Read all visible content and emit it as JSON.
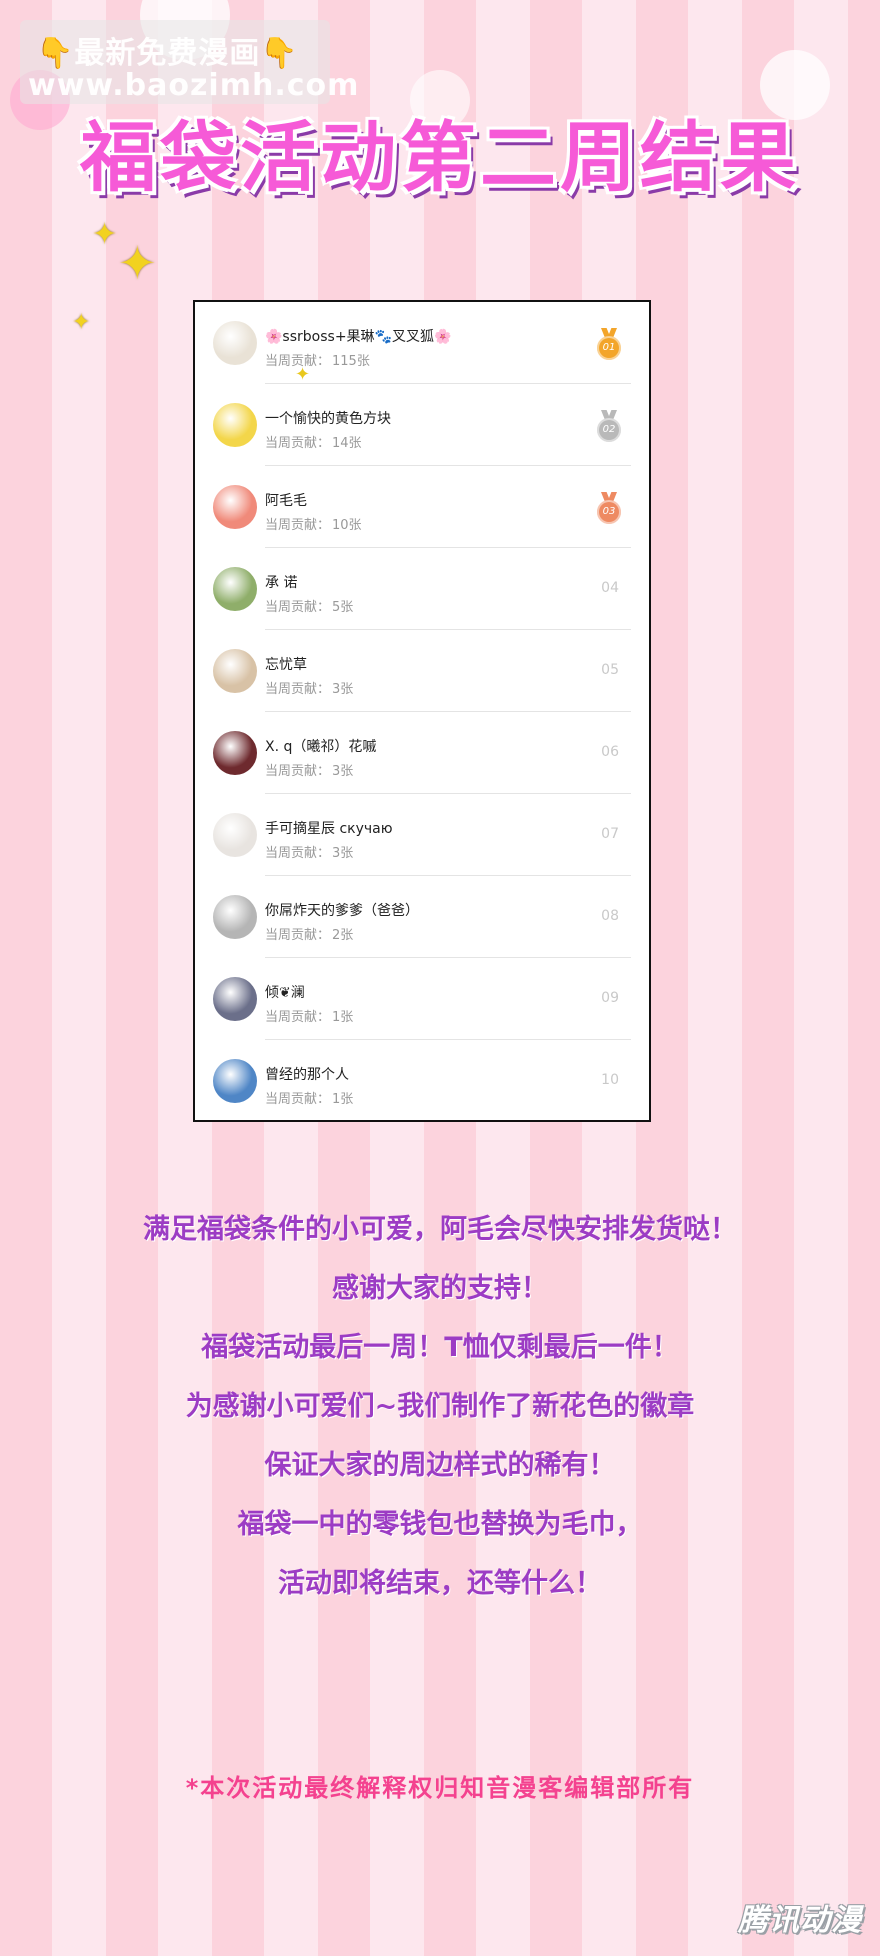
{
  "watermark": {
    "finger_left": "👇",
    "title": "最新免费漫画",
    "finger_right": "👇",
    "url": "www.baozimh.com"
  },
  "page_title": "福袋活动第二周结果",
  "ranking": {
    "contribution_label": "当周贡献：",
    "rows": [
      {
        "name": "🌸ssrboss+果琳🐾叉叉狐🌸",
        "contribution": "115张",
        "rank": "01",
        "medal": "gold",
        "avatar_color": "#e9e2d6"
      },
      {
        "name": "一个愉快的黄色方块",
        "contribution": "14张",
        "rank": "02",
        "medal": "silver",
        "avatar_color": "#f3d64a"
      },
      {
        "name": "阿毛毛",
        "contribution": "10张",
        "rank": "03",
        "medal": "bronze",
        "avatar_color": "#f08a7a"
      },
      {
        "name": "承 诺",
        "contribution": "5张",
        "rank": "04",
        "medal": "",
        "avatar_color": "#8fae6a"
      },
      {
        "name": "忘忧草",
        "contribution": "3张",
        "rank": "05",
        "medal": "",
        "avatar_color": "#d8c2a6"
      },
      {
        "name": "X. q（曦祁）花嘁",
        "contribution": "3张",
        "rank": "06",
        "medal": "",
        "avatar_color": "#6e2a2e"
      },
      {
        "name": "手可摘星辰    скучаю",
        "contribution": "3张",
        "rank": "07",
        "medal": "",
        "avatar_color": "#e8e4e0"
      },
      {
        "name": "你屌炸天的爹爹（爸爸）",
        "contribution": "2张",
        "rank": "08",
        "medal": "",
        "avatar_color": "#b5b5b5"
      },
      {
        "name": "倾❦澜",
        "contribution": "1张",
        "rank": "09",
        "medal": "",
        "avatar_color": "#6b6f8a"
      },
      {
        "name": "曾经的那个人",
        "contribution": "1张",
        "rank": "10",
        "medal": "",
        "avatar_color": "#4f86c6"
      }
    ]
  },
  "notice": [
    "满足福袋条件的小可爱，阿毛会尽快安排发货哒！",
    "感谢大家的支持！",
    "福袋活动最后一周！T恤仅剩最后一件！",
    "为感谢小可爱们~我们制作了新花色的徽章",
    "保证大家的周边样式的稀有！",
    "福袋一中的零钱包也替换为毛巾，",
    "活动即将结束，还等什么！"
  ],
  "disclaimer": "*本次活动最终解释权归知音漫客编辑部所有",
  "brand": "腾讯动漫",
  "colors": {
    "title_pink": "#f65ad7",
    "notice_purple": "#9c3cc4",
    "disclaimer_pink": "#f4428f",
    "medal_gold": "#f3a52a",
    "medal_silver": "#b9b9b9",
    "medal_bronze": "#ee8a62"
  }
}
